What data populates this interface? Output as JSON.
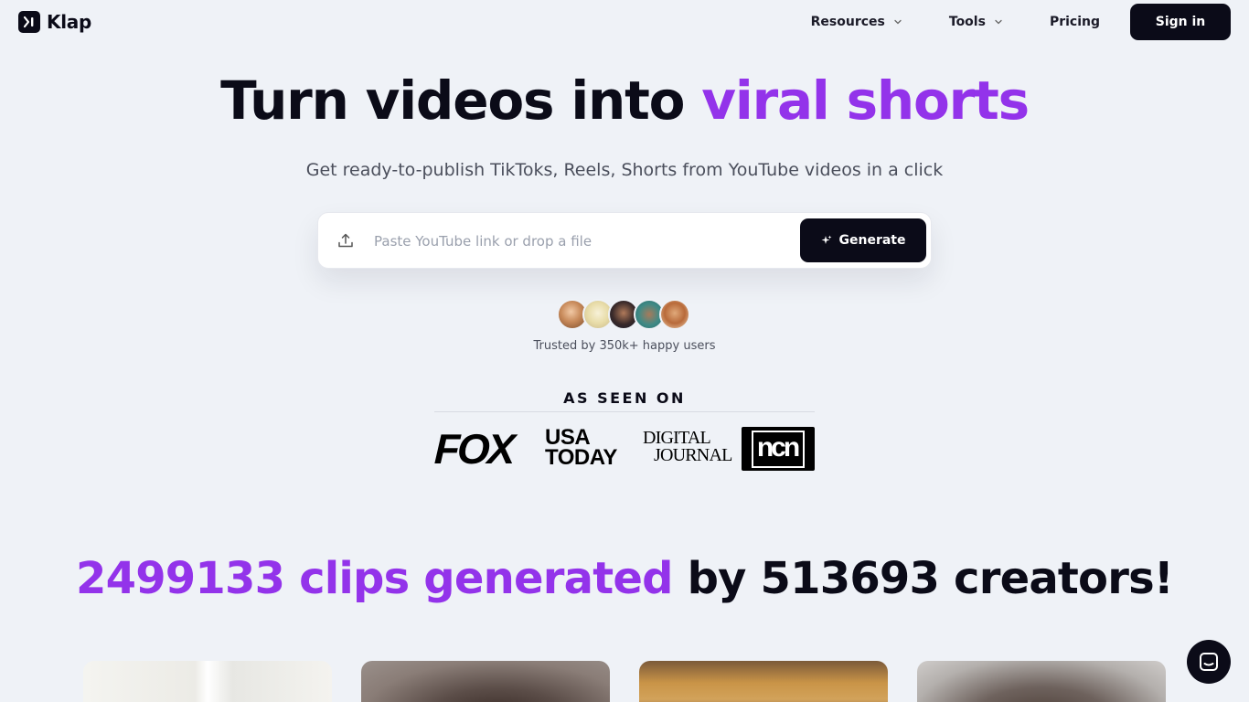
{
  "brand": {
    "name": "Klap"
  },
  "nav": {
    "resources": "Resources",
    "tools": "Tools",
    "pricing": "Pricing",
    "signin": "Sign in"
  },
  "hero": {
    "title_main": "Turn videos into ",
    "title_accent": "viral shorts",
    "subtitle": "Get ready-to-publish TikToks, Reels, Shorts from YouTube videos in a click"
  },
  "input": {
    "placeholder": "Paste YouTube link or drop a file",
    "value": "",
    "generate_label": "Generate"
  },
  "social_proof": {
    "trusted": "Trusted by 350k+ happy users"
  },
  "press": {
    "title": "AS SEEN ON",
    "fox": "FOX",
    "usa_line1": "USA",
    "usa_line2": "TODAY",
    "dj_line1": "DIGITAL",
    "dj_line2": "JOURNAL",
    "ncn": "ncn"
  },
  "stats": {
    "clips": "2499133 clips generated",
    "creators": " by 513693 creators!"
  },
  "colors": {
    "accent": "#9333ea",
    "dark": "#0b0b18",
    "background": "#eff2f7"
  },
  "icons": {
    "upload": "upload-icon",
    "sparkle": "sparkle-icon",
    "chat": "chat-icon",
    "chevron": "chevron-down-icon"
  }
}
